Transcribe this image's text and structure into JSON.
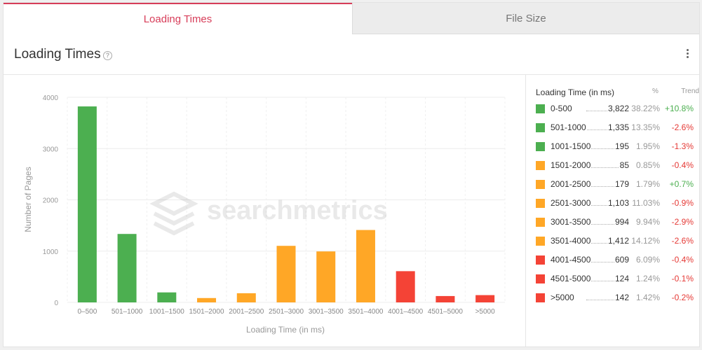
{
  "tabs": [
    {
      "label": "Loading Times",
      "active": true
    },
    {
      "label": "File Size",
      "active": false
    }
  ],
  "header": {
    "title": "Loading Times"
  },
  "colors": {
    "accent": "#d73d59",
    "green": "#4caf50",
    "orange": "#ffa726",
    "red": "#f44336",
    "trend_up": "#4caf50",
    "trend_down": "#e53935"
  },
  "watermark": "searchmetrics",
  "chart_data": {
    "type": "bar",
    "title": "",
    "xlabel": "Loading Time (in ms)",
    "ylabel": "Number of Pages",
    "ylim": [
      0,
      4000
    ],
    "yticks": [
      0,
      1000,
      2000,
      3000,
      4000
    ],
    "categories": [
      "0–500",
      "501–1000",
      "1001–1500",
      "1501–2000",
      "2001–2500",
      "2501–3000",
      "3001–3500",
      "3501–4000",
      "4001–4500",
      "4501–5000",
      ">5000"
    ],
    "values": [
      3822,
      1335,
      195,
      85,
      179,
      1103,
      994,
      1412,
      609,
      124,
      142
    ],
    "bar_colors": [
      "#4caf50",
      "#4caf50",
      "#4caf50",
      "#ffa726",
      "#ffa726",
      "#ffa726",
      "#ffa726",
      "#ffa726",
      "#f44336",
      "#f44336",
      "#f44336"
    ],
    "grid": true
  },
  "legend": {
    "header": {
      "label": "Loading Time (in ms)",
      "pct": "%",
      "trend": "Trend"
    },
    "rows": [
      {
        "label": "0-500",
        "value": "3,822",
        "pct": "38.22%",
        "trend": "+10.8%",
        "color": "#4caf50",
        "trend_color": "#4caf50"
      },
      {
        "label": "501-1000",
        "value": "1,335",
        "pct": "13.35%",
        "trend": "-2.6%",
        "color": "#4caf50",
        "trend_color": "#e53935"
      },
      {
        "label": "1001-1500",
        "value": "195",
        "pct": "1.95%",
        "trend": "-1.3%",
        "color": "#4caf50",
        "trend_color": "#e53935"
      },
      {
        "label": "1501-2000",
        "value": "85",
        "pct": "0.85%",
        "trend": "-0.4%",
        "color": "#ffa726",
        "trend_color": "#e53935"
      },
      {
        "label": "2001-2500",
        "value": "179",
        "pct": "1.79%",
        "trend": "+0.7%",
        "color": "#ffa726",
        "trend_color": "#4caf50"
      },
      {
        "label": "2501-3000",
        "value": "1,103",
        "pct": "11.03%",
        "trend": "-0.9%",
        "color": "#ffa726",
        "trend_color": "#e53935"
      },
      {
        "label": "3001-3500",
        "value": "994",
        "pct": "9.94%",
        "trend": "-2.9%",
        "color": "#ffa726",
        "trend_color": "#e53935"
      },
      {
        "label": "3501-4000",
        "value": "1,412",
        "pct": "14.12%",
        "trend": "-2.6%",
        "color": "#ffa726",
        "trend_color": "#e53935"
      },
      {
        "label": "4001-4500",
        "value": "609",
        "pct": "6.09%",
        "trend": "-0.4%",
        "color": "#f44336",
        "trend_color": "#e53935"
      },
      {
        "label": "4501-5000",
        "value": "124",
        "pct": "1.24%",
        "trend": "-0.1%",
        "color": "#f44336",
        "trend_color": "#e53935"
      },
      {
        "label": ">5000",
        "value": "142",
        "pct": "1.42%",
        "trend": "-0.2%",
        "color": "#f44336",
        "trend_color": "#e53935"
      }
    ]
  }
}
